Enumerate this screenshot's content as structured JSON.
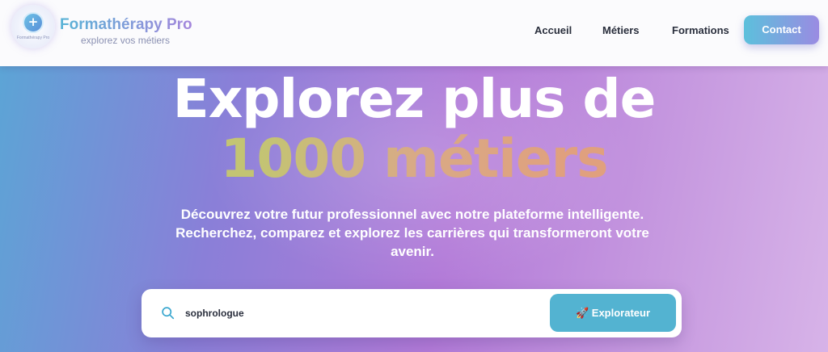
{
  "header": {
    "brand": "Formathérapy Pro",
    "tagline": "explorez vos métiers",
    "logo_text": "Formathérapy Pro",
    "logo_icon": "medical-cross-icon",
    "nav": [
      {
        "label": "Accueil"
      },
      {
        "label": "Métiers"
      },
      {
        "label": "Formations"
      }
    ],
    "contact_label": "Contact"
  },
  "hero": {
    "title_line1": "Explorez plus de",
    "title_line2": "1000 métiers",
    "description": "Découvrez votre futur professionnel avec notre plateforme intelligente. Recherchez, comparez et explorez les carrières qui transformeront votre avenir."
  },
  "search": {
    "value": "sophrologue",
    "icon": "search-icon",
    "button_label": "🚀 Explorateur"
  },
  "colors": {
    "accent": "#53b3d1",
    "brand_gradient_start": "#58b3d6",
    "brand_gradient_end": "#a586dc"
  }
}
